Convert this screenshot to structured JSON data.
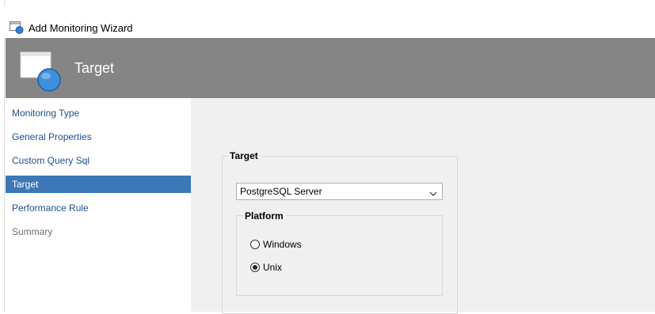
{
  "window": {
    "title": "Add Monitoring Wizard"
  },
  "header": {
    "title": "Target"
  },
  "nav": {
    "items": [
      {
        "label": "Monitoring Type",
        "state": "normal"
      },
      {
        "label": "General Properties",
        "state": "normal"
      },
      {
        "label": "Custom Query Sql",
        "state": "normal"
      },
      {
        "label": "Target",
        "state": "active"
      },
      {
        "label": "Performance Rule",
        "state": "normal"
      },
      {
        "label": "Summary",
        "state": "disabled"
      }
    ]
  },
  "target": {
    "group_label": "Target",
    "selected": "PostgreSQL Server",
    "platform": {
      "group_label": "Platform",
      "options": [
        {
          "label": "Windows",
          "checked": false
        },
        {
          "label": "Unix",
          "checked": true
        }
      ]
    }
  },
  "colors": {
    "header_bg": "#858585",
    "active_nav_bg": "#3c77b7",
    "nav_link": "#1b4f8c",
    "content_bg": "#f0f0f0"
  }
}
